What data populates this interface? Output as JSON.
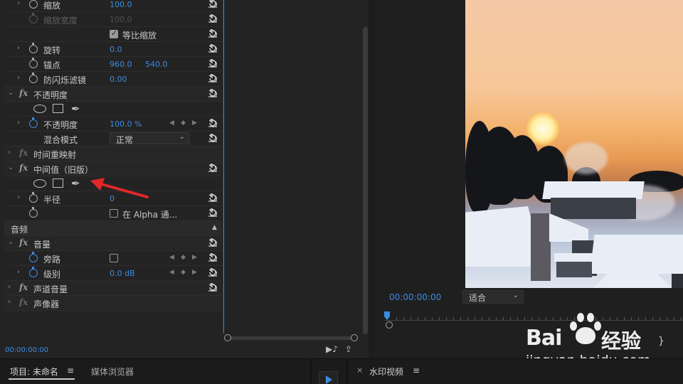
{
  "effect_controls": {
    "rows": [
      {
        "id": "scale",
        "label": "缩放",
        "values": [
          "100.0"
        ]
      },
      {
        "id": "scale-width",
        "label": "缩放宽度",
        "values": [
          "100.0"
        ],
        "disabled": true
      },
      {
        "id": "uniform-scale",
        "label": "等比缩放",
        "checked": true
      },
      {
        "id": "rotation",
        "label": "旋转",
        "values": [
          "0.0"
        ]
      },
      {
        "id": "anchor",
        "label": "锚点",
        "values": [
          "960.0",
          "540.0"
        ]
      },
      {
        "id": "anti-flicker",
        "label": "防闪烁滤镜",
        "values": [
          "0.00"
        ]
      },
      {
        "id": "opacity-section",
        "label": "不透明度"
      },
      {
        "id": "opacity",
        "label": "不透明度",
        "values": [
          "100.0 %"
        ]
      },
      {
        "id": "blend-mode",
        "label": "混合模式",
        "dropdown": "正常"
      },
      {
        "id": "time-remap",
        "label": "时间重映射"
      },
      {
        "id": "median-legacy",
        "label": "中间值（旧版）"
      },
      {
        "id": "radius",
        "label": "半径",
        "values": [
          "0"
        ]
      },
      {
        "id": "alpha-channel",
        "label": "在 Alpha 通..."
      },
      {
        "id": "audio-header",
        "label": "音频"
      },
      {
        "id": "volume",
        "label": "音量"
      },
      {
        "id": "bypass",
        "label": "旁路"
      },
      {
        "id": "level",
        "label": "级别",
        "values": [
          "0.0 dB"
        ]
      },
      {
        "id": "channel-volume",
        "label": "声道音量"
      },
      {
        "id": "panner",
        "label": "声像器"
      }
    ],
    "timecode": "00:00:00:00"
  },
  "monitor": {
    "timecode": "00:00:00:00",
    "fit_label": "适合"
  },
  "bottom": {
    "project_tab": "项目: 未命名",
    "menu_glyph": "≡",
    "media_browser_tab": "媒体浏览器",
    "close_glyph": "×",
    "sequence_tab": "水印视频"
  },
  "watermark": {
    "brand_latin": "Bai",
    "brand_cn": "经验",
    "url": "jingyan.baidu.com"
  },
  "colors": {
    "accent": "#3b8ce0",
    "arrow": "#e02828"
  }
}
